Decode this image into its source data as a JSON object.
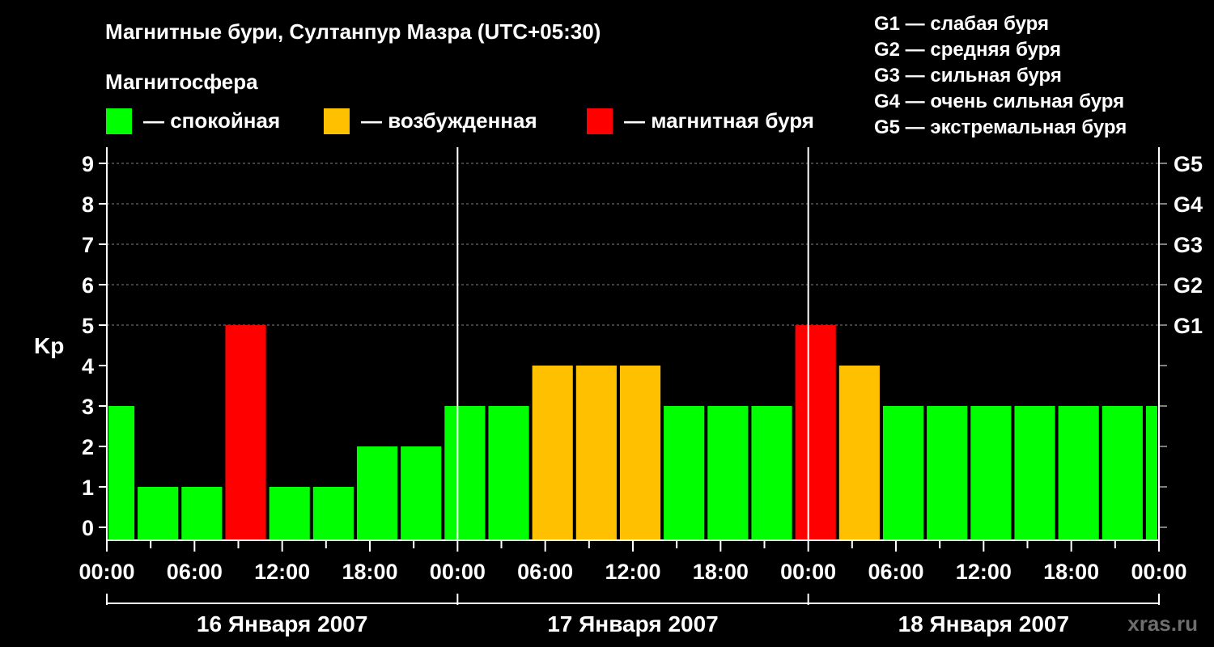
{
  "header": {
    "title": "Магнитные бури, Султанпур Мазра (UTC+05:30)",
    "magnetosphere_label": "Магнитосфера",
    "watermark": "xras.ru"
  },
  "legend": {
    "items": [
      {
        "label": "— спокойная",
        "color": "#00ff00"
      },
      {
        "label": "— возбужденная",
        "color": "#ffc000"
      },
      {
        "label": "— магнитная буря",
        "color": "#ff0000"
      }
    ]
  },
  "storm_scale": [
    "G1 — слабая буря",
    "G2 — средняя буря",
    "G3 — сильная буря",
    "G4 — очень сильная буря",
    "G5 — экстремальная буря"
  ],
  "colors": {
    "background": "#000000",
    "quiet": "#00ff00",
    "disturbed": "#ffc000",
    "storm": "#ff0000",
    "axis": "#ffffff",
    "grid": "#808080"
  },
  "chart_data": {
    "type": "bar",
    "ylabel": "Kp",
    "ylim": [
      0,
      9
    ],
    "yticks": [
      "0",
      "1",
      "2",
      "3",
      "4",
      "5",
      "6",
      "7",
      "8",
      "9"
    ],
    "g_levels": [
      {
        "kp": 5,
        "label": "G1"
      },
      {
        "kp": 6,
        "label": "G2"
      },
      {
        "kp": 7,
        "label": "G3"
      },
      {
        "kp": 8,
        "label": "G4"
      },
      {
        "kp": 9,
        "label": "G5"
      }
    ],
    "grid": "dashed horizontal at Kp 5–9",
    "x_tick_labels": [
      "00:00",
      "06:00",
      "12:00",
      "18:00",
      "00:00",
      "06:00",
      "12:00",
      "18:00",
      "00:00",
      "06:00",
      "12:00",
      "18:00",
      "00:00"
    ],
    "days": [
      "16 Января 2007",
      "17 Января 2007",
      "18 Января 2007"
    ],
    "bars": [
      {
        "start_hour": 0,
        "end_hour": 2,
        "kp": 3,
        "level": "quiet"
      },
      {
        "start_hour": 2,
        "end_hour": 5,
        "kp": 1,
        "level": "quiet"
      },
      {
        "start_hour": 5,
        "end_hour": 8,
        "kp": 1,
        "level": "quiet"
      },
      {
        "start_hour": 8,
        "end_hour": 11,
        "kp": 5,
        "level": "storm"
      },
      {
        "start_hour": 11,
        "end_hour": 14,
        "kp": 1,
        "level": "quiet"
      },
      {
        "start_hour": 14,
        "end_hour": 17,
        "kp": 1,
        "level": "quiet"
      },
      {
        "start_hour": 17,
        "end_hour": 20,
        "kp": 2,
        "level": "quiet"
      },
      {
        "start_hour": 20,
        "end_hour": 23,
        "kp": 2,
        "level": "quiet"
      },
      {
        "start_hour": 23,
        "end_hour": 26,
        "kp": 3,
        "level": "quiet"
      },
      {
        "start_hour": 26,
        "end_hour": 29,
        "kp": 3,
        "level": "quiet"
      },
      {
        "start_hour": 29,
        "end_hour": 32,
        "kp": 4,
        "level": "disturbed"
      },
      {
        "start_hour": 32,
        "end_hour": 35,
        "kp": 4,
        "level": "disturbed"
      },
      {
        "start_hour": 35,
        "end_hour": 38,
        "kp": 4,
        "level": "disturbed"
      },
      {
        "start_hour": 38,
        "end_hour": 41,
        "kp": 3,
        "level": "quiet"
      },
      {
        "start_hour": 41,
        "end_hour": 44,
        "kp": 3,
        "level": "quiet"
      },
      {
        "start_hour": 44,
        "end_hour": 47,
        "kp": 3,
        "level": "quiet"
      },
      {
        "start_hour": 47,
        "end_hour": 50,
        "kp": 5,
        "level": "storm"
      },
      {
        "start_hour": 50,
        "end_hour": 53,
        "kp": 4,
        "level": "disturbed"
      },
      {
        "start_hour": 53,
        "end_hour": 56,
        "kp": 3,
        "level": "quiet"
      },
      {
        "start_hour": 56,
        "end_hour": 59,
        "kp": 3,
        "level": "quiet"
      },
      {
        "start_hour": 59,
        "end_hour": 62,
        "kp": 3,
        "level": "quiet"
      },
      {
        "start_hour": 62,
        "end_hour": 65,
        "kp": 3,
        "level": "quiet"
      },
      {
        "start_hour": 65,
        "end_hour": 68,
        "kp": 3,
        "level": "quiet"
      },
      {
        "start_hour": 68,
        "end_hour": 71,
        "kp": 3,
        "level": "quiet"
      },
      {
        "start_hour": 71,
        "end_hour": 72,
        "kp": 3,
        "level": "quiet"
      }
    ]
  }
}
